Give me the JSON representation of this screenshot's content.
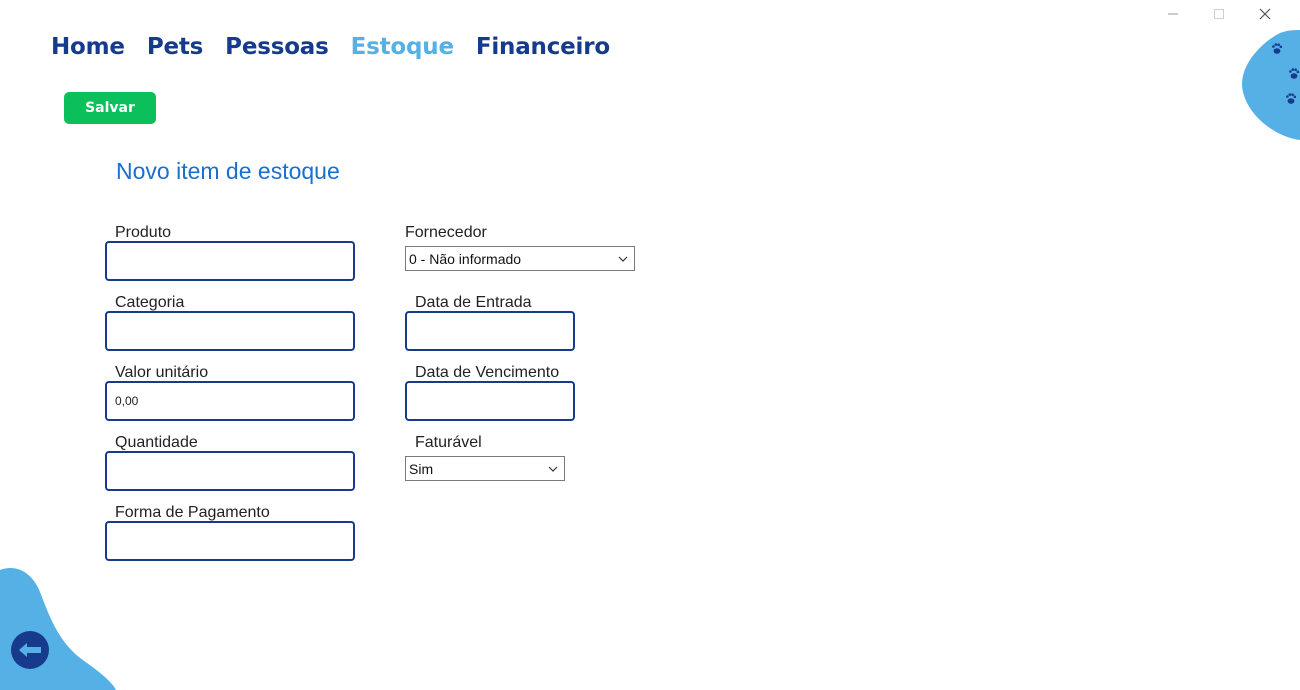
{
  "window": {
    "minimize_icon": "minimize-icon",
    "maximize_icon": "maximize-icon",
    "close_icon": "close-icon"
  },
  "nav": {
    "items": [
      {
        "label": "Home",
        "active": false
      },
      {
        "label": "Pets",
        "active": false
      },
      {
        "label": "Pessoas",
        "active": false
      },
      {
        "label": "Estoque",
        "active": true
      },
      {
        "label": "Financeiro",
        "active": false
      }
    ]
  },
  "toolbar": {
    "save_label": "Salvar"
  },
  "form": {
    "title": "Novo item de estoque",
    "produto": {
      "label": "Produto",
      "value": ""
    },
    "categoria": {
      "label": "Categoria",
      "value": ""
    },
    "valor_unitario": {
      "label": "Valor unitário",
      "value": "0,00"
    },
    "quantidade": {
      "label": "Quantidade",
      "value": ""
    },
    "forma_pagamento": {
      "label": "Forma de Pagamento",
      "value": ""
    },
    "fornecedor": {
      "label": "Fornecedor",
      "selected": "0 - Não informado"
    },
    "data_entrada": {
      "label": "Data de Entrada",
      "value": ""
    },
    "data_vencimento": {
      "label": "Data de Vencimento",
      "value": ""
    },
    "faturavel": {
      "label": "Faturável",
      "selected": "Sim"
    }
  },
  "decorations": {
    "paw_icon": "paw-icon",
    "back_icon": "back-arrow-icon"
  },
  "colors": {
    "primary": "#163b8c",
    "active_nav": "#55b0e6",
    "save": "#0bbf5b",
    "title": "#1a6fcf",
    "blob": "#55b0e6"
  }
}
